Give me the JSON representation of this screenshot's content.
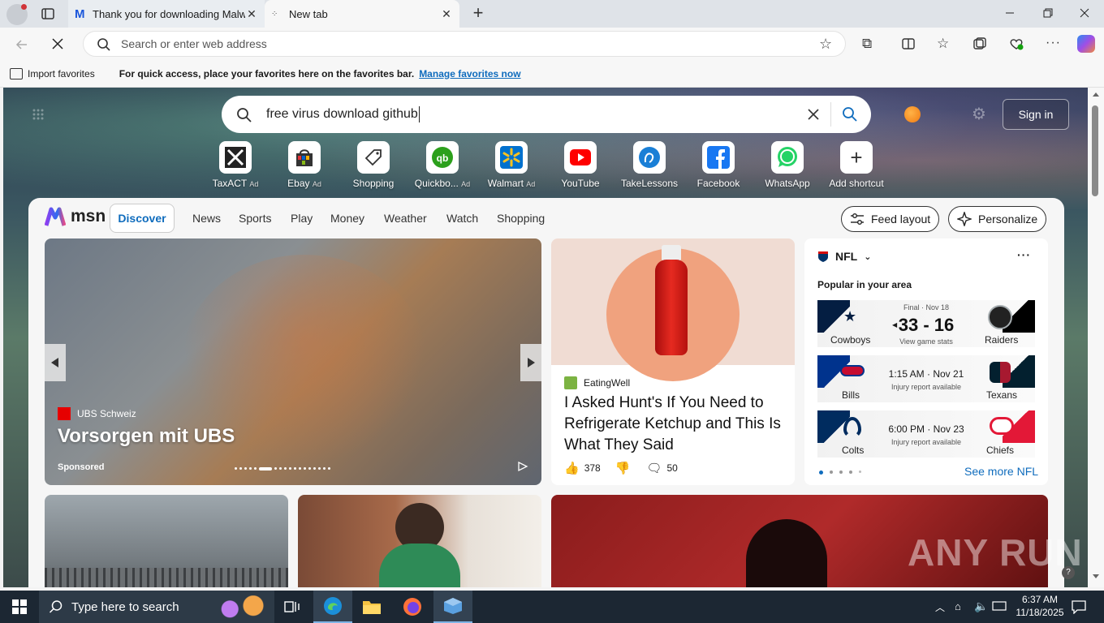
{
  "browser": {
    "tabs": [
      {
        "label": "Thank you for downloading Malw"
      },
      {
        "label": "New tab"
      }
    ],
    "address_placeholder": "Search or enter web address",
    "favbar": {
      "import_label": "Import favorites",
      "message": "For quick access, place your favorites here on the favorites bar.",
      "manage_link": "Manage favorites now"
    }
  },
  "newtab": {
    "search_value": "free virus download github",
    "signin_label": "Sign in",
    "shortcuts": [
      {
        "label": "TaxACT",
        "ad": "Ad"
      },
      {
        "label": "Ebay",
        "ad": "Ad"
      },
      {
        "label": "Shopping",
        "ad": ""
      },
      {
        "label": "Quickbo...",
        "ad": "Ad"
      },
      {
        "label": "Walmart",
        "ad": "Ad"
      },
      {
        "label": "YouTube",
        "ad": ""
      },
      {
        "label": "TakeLessons",
        "ad": ""
      },
      {
        "label": "Facebook",
        "ad": ""
      },
      {
        "label": "WhatsApp",
        "ad": ""
      },
      {
        "label": "Add shortcut",
        "ad": ""
      }
    ]
  },
  "feed": {
    "logo": "msn",
    "nav": [
      "Discover",
      "News",
      "Sports",
      "Play",
      "Money",
      "Weather",
      "Watch",
      "Shopping"
    ],
    "feed_layout": "Feed layout",
    "personalize": "Personalize",
    "hero": {
      "source": "UBS Schweiz",
      "title": "Vorsorgen mit UBS",
      "sponsored": "Sponsored"
    },
    "article": {
      "source": "EatingWell",
      "title": "I Asked Hunt's If You Need to Refrigerate Ketchup and This Is What They Said",
      "likes": "378",
      "comments": "50"
    },
    "nfl": {
      "league": "NFL",
      "subtitle": "Popular in your area",
      "games": [
        {
          "home": "Cowboys",
          "away": "Raiders",
          "status": "Final · Nov 18",
          "score": "33 - 16",
          "note": "View game stats"
        },
        {
          "home": "Bills",
          "away": "Texans",
          "status": "1:15 AM · Nov 21",
          "score": "",
          "note": "Injury report available"
        },
        {
          "home": "Colts",
          "away": "Chiefs",
          "status": "6:00 PM · Nov 23",
          "score": "",
          "note": "Injury report available"
        }
      ],
      "see_more": "See more NFL"
    }
  },
  "watermark": "ANY RUN",
  "taskbar": {
    "search_placeholder": "Type here to search",
    "time": "6:37 AM",
    "date": "11/18/2025"
  },
  "colors": {
    "accent": "#0f6cbd",
    "taskbar": "#1c2733"
  }
}
